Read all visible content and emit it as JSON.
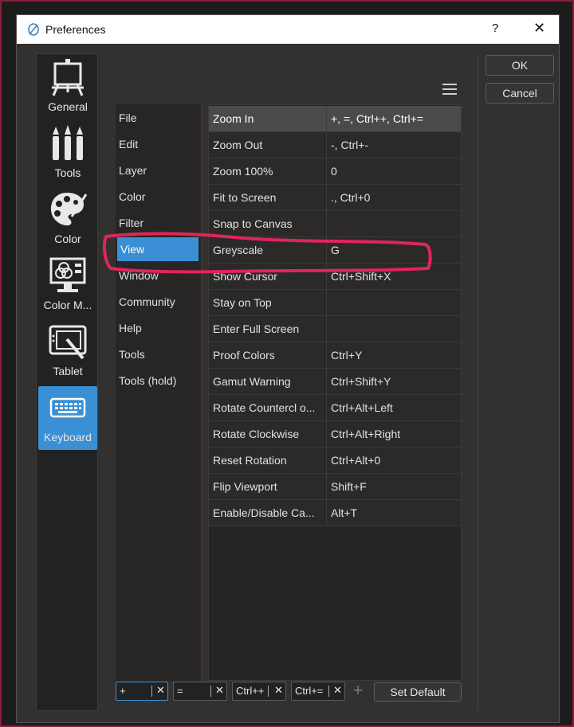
{
  "window": {
    "title": "Preferences",
    "help": "?",
    "close": "✕"
  },
  "buttons": {
    "ok": "OK",
    "cancel": "Cancel",
    "set_default": "Set Default",
    "add": "+"
  },
  "categories": [
    {
      "label": "General",
      "icon": "easel-icon"
    },
    {
      "label": "Tools",
      "icon": "brushes-icon"
    },
    {
      "label": "Color",
      "icon": "palette-icon"
    },
    {
      "label": "Color M...",
      "icon": "color-management-icon"
    },
    {
      "label": "Tablet",
      "icon": "tablet-icon"
    },
    {
      "label": "Keyboard",
      "icon": "keyboard-icon",
      "active": true
    }
  ],
  "sections": [
    {
      "label": "File"
    },
    {
      "label": "Edit"
    },
    {
      "label": "Layer"
    },
    {
      "label": "Color"
    },
    {
      "label": "Filter"
    },
    {
      "label": "View",
      "active": true
    },
    {
      "label": "Window"
    },
    {
      "label": "Community"
    },
    {
      "label": "Help"
    },
    {
      "label": "Tools"
    },
    {
      "label": "Tools (hold)"
    }
  ],
  "shortcuts": [
    {
      "action": "Zoom In",
      "keys": "+, =, Ctrl++, Ctrl+="
    },
    {
      "action": "Zoom Out",
      "keys": "-, Ctrl+-"
    },
    {
      "action": "Zoom 100%",
      "keys": "0"
    },
    {
      "action": "Fit to Screen",
      "keys": "., Ctrl+0"
    },
    {
      "action": "Snap to Canvas",
      "keys": ""
    },
    {
      "action": "Greyscale",
      "keys": "G"
    },
    {
      "action": "Show Cursor",
      "keys": "Ctrl+Shift+X"
    },
    {
      "action": "Stay on Top",
      "keys": ""
    },
    {
      "action": "Enter Full Screen",
      "keys": ""
    },
    {
      "action": "Proof Colors",
      "keys": "Ctrl+Y"
    },
    {
      "action": "Gamut Warning",
      "keys": "Ctrl+Shift+Y"
    },
    {
      "action": "Rotate Countercl o...",
      "keys": "Ctrl+Alt+Left"
    },
    {
      "action": "Rotate Clockwise",
      "keys": "Ctrl+Alt+Right"
    },
    {
      "action": "Reset Rotation",
      "keys": "Ctrl+Alt+0"
    },
    {
      "action": "Flip Viewport",
      "keys": "Shift+F"
    },
    {
      "action": "Enable/Disable Ca...",
      "keys": "Alt+T"
    }
  ],
  "selected_shortcut": "Zoom In",
  "key_chips": [
    {
      "value": "+"
    },
    {
      "value": "="
    },
    {
      "value": "Ctrl++"
    },
    {
      "value": "Ctrl+="
    }
  ],
  "colors": {
    "accent": "#3b8fd4",
    "annotation": "#e0245e",
    "background": "#333130"
  }
}
